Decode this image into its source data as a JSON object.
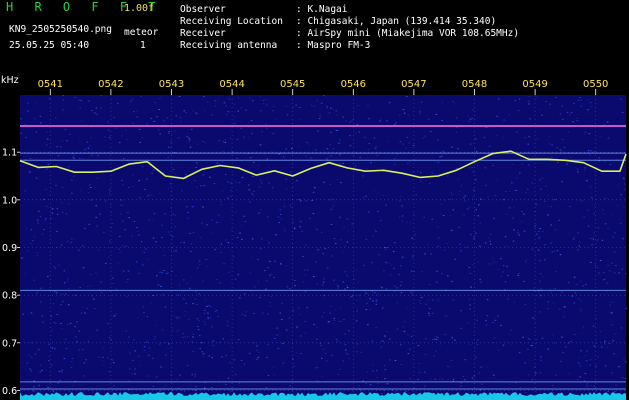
{
  "header": {
    "app_name": "H R O F F T",
    "version": "1.00f",
    "filename": "KN9_2505250540.png",
    "datetime": "25.05.25 05:40",
    "meteor_label": "meteor",
    "meteor_count": "1",
    "info": [
      {
        "label": "Observer",
        "value": ": K.Nagai"
      },
      {
        "label": "Receiving Location",
        "value": ": Chigasaki, Japan (139.414 35.340)"
      },
      {
        "label": "Receiver",
        "value": ": AirSpy mini (Miakejima VOR 108.65MHz)"
      },
      {
        "label": "Receiving antenna",
        "value": ": Maspro FM-3"
      }
    ]
  },
  "colors": {
    "background": "#0a0a6e",
    "trace": "#d8f060",
    "marker": "#e060d0",
    "line": "#7fb0ff",
    "grid": "#5566cc",
    "tick_label": "#ffe35a"
  },
  "chart_data": {
    "type": "heatmap",
    "title": "",
    "ylabel": "kHz",
    "xlabel": "",
    "x_tick_labels": [
      "0541",
      "0542",
      "0543",
      "0544",
      "0545",
      "0546",
      "0547",
      "0548",
      "0549",
      "0550"
    ],
    "y_tick_labels": [
      "1.1",
      "1.0",
      "0.9",
      "0.8",
      "0.7",
      "0.6"
    ],
    "ylim": [
      0.58,
      1.22
    ],
    "xlim": [
      0,
      10
    ],
    "grid": true,
    "horizontal_lines_khz": [
      1.155,
      1.098,
      1.083,
      0.81,
      0.618,
      0.603
    ],
    "doppler_trace": {
      "x": [
        0.0,
        0.3,
        0.6,
        0.9,
        1.2,
        1.5,
        1.8,
        2.1,
        2.4,
        2.7,
        3.0,
        3.3,
        3.6,
        3.9,
        4.2,
        4.5,
        4.8,
        5.1,
        5.4,
        5.7,
        6.0,
        6.3,
        6.6,
        6.9,
        7.2,
        7.5,
        7.8,
        8.1,
        8.4,
        8.7,
        9.0,
        9.3,
        9.6,
        9.9,
        10.0
      ],
      "y": [
        1.082,
        1.068,
        1.07,
        1.058,
        1.058,
        1.06,
        1.075,
        1.08,
        1.05,
        1.045,
        1.064,
        1.072,
        1.067,
        1.052,
        1.061,
        1.05,
        1.066,
        1.078,
        1.067,
        1.06,
        1.062,
        1.056,
        1.047,
        1.05,
        1.062,
        1.08,
        1.097,
        1.102,
        1.085,
        1.085,
        1.083,
        1.078,
        1.06,
        1.06,
        1.096
      ]
    }
  }
}
